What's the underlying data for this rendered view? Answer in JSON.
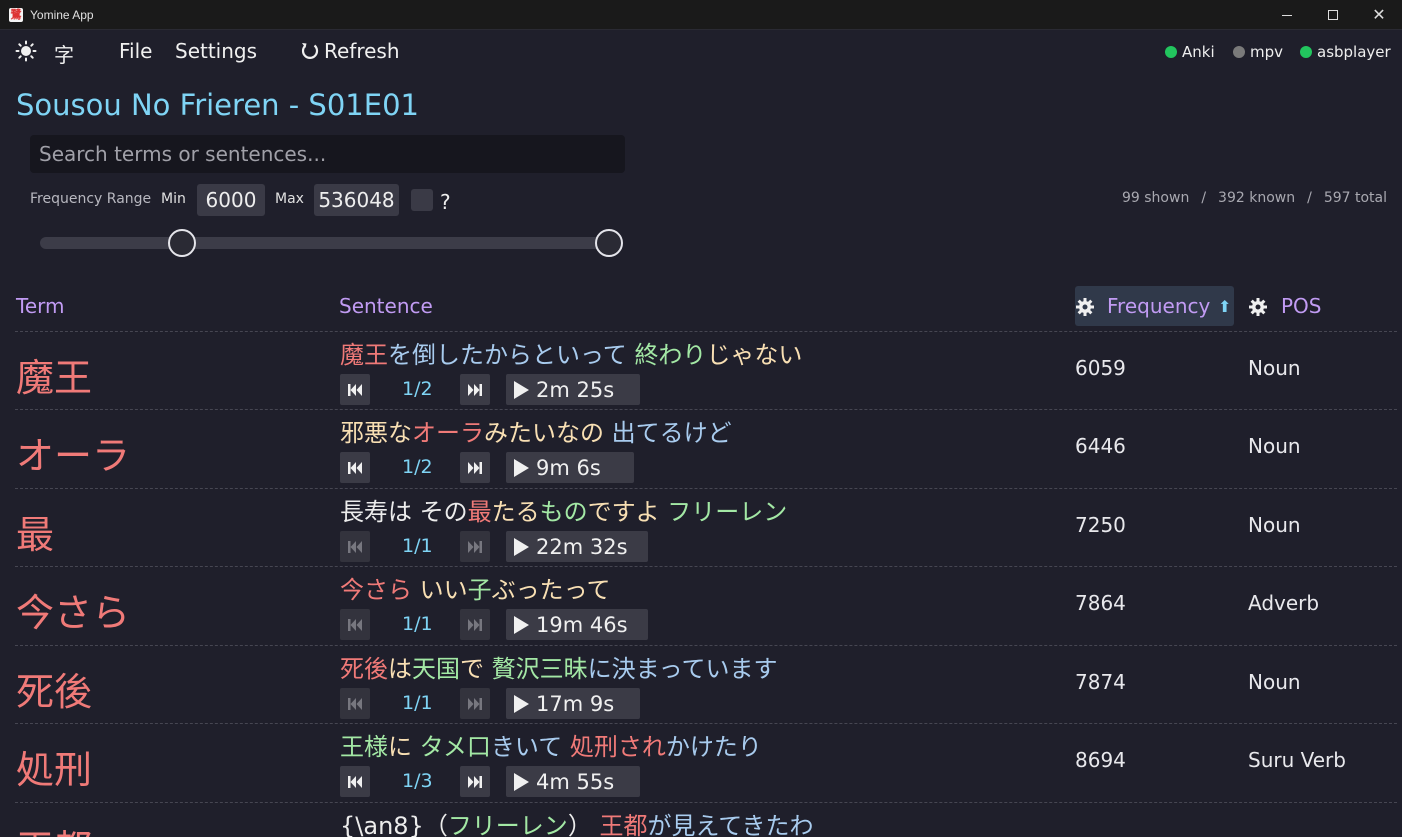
{
  "window": {
    "title": "Yomine App"
  },
  "menu": {
    "file": "File",
    "settings": "Settings",
    "refresh": "Refresh",
    "kanji": "字"
  },
  "status": [
    {
      "label": "Anki",
      "color": "#22c55e"
    },
    {
      "label": "mpv",
      "color": "#7a7a7a"
    },
    {
      "label": "asbplayer",
      "color": "#22c55e"
    }
  ],
  "page": {
    "title": "Sousou No Frieren - S01E01"
  },
  "search": {
    "placeholder": "Search terms or sentences..."
  },
  "filter": {
    "label": "Frequency Range",
    "min_label": "Min",
    "min": "6000",
    "max_label": "Max",
    "max": "536048",
    "help": "?",
    "slider_low_fraction": 0.25,
    "slider_high_fraction": 1.0
  },
  "counts": {
    "shown": "99 shown",
    "sep": "/",
    "known": "392 known",
    "total": "597 total"
  },
  "table": {
    "headers": {
      "term": "Term",
      "sentence": "Sentence",
      "frequency": "Frequency",
      "pos": "POS"
    },
    "rows": [
      {
        "term": "魔王",
        "sentence": [
          [
            "魔王",
            "red"
          ],
          [
            "を倒したからといって ",
            "blue"
          ],
          [
            "終わり",
            "green"
          ],
          [
            "じゃない",
            "yellow"
          ]
        ],
        "counter": "1/2",
        "time": "2m 25s",
        "frequency": "6059",
        "pos": "Noun",
        "nav_enabled": true
      },
      {
        "term": "オーラ",
        "sentence": [
          [
            "邪悪な",
            "yellow"
          ],
          [
            "オーラ",
            "red"
          ],
          [
            "みたいなの ",
            "yellow"
          ],
          [
            "出てるけど",
            "blue"
          ]
        ],
        "counter": "1/2",
        "time": "9m 6s",
        "frequency": "6446",
        "pos": "Noun",
        "nav_enabled": true
      },
      {
        "term": "最",
        "sentence": [
          [
            "長寿は その",
            "white"
          ],
          [
            "最",
            "red"
          ],
          [
            "たる",
            "yellow"
          ],
          [
            "もの",
            "green"
          ],
          [
            "ですよ ",
            "yellow"
          ],
          [
            "フリーレン",
            "green"
          ]
        ],
        "counter": "1/1",
        "time": "22m 32s",
        "frequency": "7250",
        "pos": "Noun",
        "nav_enabled": false
      },
      {
        "term": "今さら",
        "sentence": [
          [
            "今さら ",
            "red"
          ],
          [
            "いい",
            "yellow"
          ],
          [
            "子",
            "green"
          ],
          [
            "ぶったって",
            "yellow"
          ]
        ],
        "counter": "1/1",
        "time": "19m 46s",
        "frequency": "7864",
        "pos": "Adverb",
        "nav_enabled": false
      },
      {
        "term": "死後",
        "sentence": [
          [
            "死後",
            "red"
          ],
          [
            "は",
            "yellow"
          ],
          [
            "天国",
            "green"
          ],
          [
            "で ",
            "yellow"
          ],
          [
            "贅沢三昧",
            "green"
          ],
          [
            "に決まっています",
            "blue"
          ]
        ],
        "counter": "1/1",
        "time": "17m 9s",
        "frequency": "7874",
        "pos": "Noun",
        "nav_enabled": false
      },
      {
        "term": "処刑",
        "sentence": [
          [
            "王様",
            "green"
          ],
          [
            "に ",
            "yellow"
          ],
          [
            "タメ口",
            "green"
          ],
          [
            "きいて ",
            "blue"
          ],
          [
            "処刑され",
            "red"
          ],
          [
            "かけたり",
            "blue"
          ]
        ],
        "counter": "1/3",
        "time": "4m 55s",
        "frequency": "8694",
        "pos": "Suru Verb",
        "nav_enabled": true
      },
      {
        "term": "王都",
        "sentence": [
          [
            "{\\an8}（",
            "white"
          ],
          [
            "フリーレン",
            "green"
          ],
          [
            "） ",
            "white"
          ],
          [
            "王都",
            "red"
          ],
          [
            "が見えてきたわ",
            "blue"
          ]
        ],
        "counter": "",
        "time": "",
        "frequency": "",
        "pos": "",
        "nav_enabled": true
      }
    ]
  }
}
